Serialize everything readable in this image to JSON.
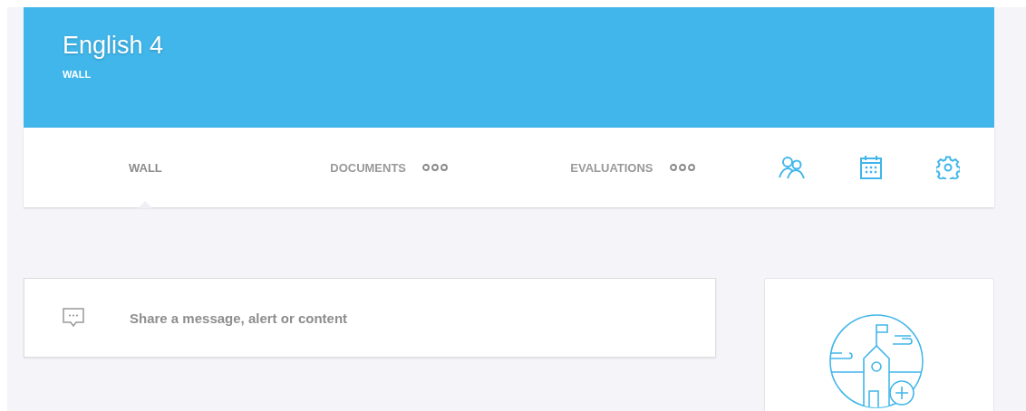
{
  "header": {
    "title": "English 4",
    "subtitle": "WALL"
  },
  "tabs": [
    {
      "label": "WALL",
      "selected": true,
      "more": false
    },
    {
      "label": "DOCUMENTS",
      "selected": false,
      "more": true
    },
    {
      "label": "EVALUATIONS",
      "selected": false,
      "more": true
    }
  ],
  "tool_icons": [
    {
      "kind": "people"
    },
    {
      "kind": "calendar"
    },
    {
      "kind": "settings"
    }
  ],
  "composer": {
    "placeholder": "Share a message, alert or content"
  }
}
